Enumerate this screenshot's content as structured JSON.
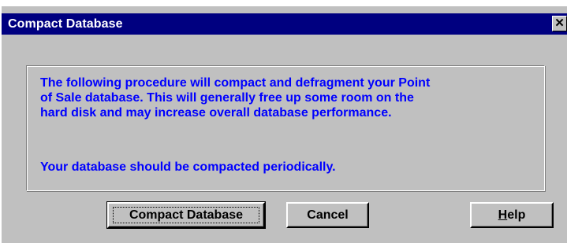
{
  "dialog": {
    "title": "Compact Database",
    "close_glyph": "✕",
    "close_icon": "close-icon"
  },
  "message": {
    "paragraph_1_lines": [
      "The following procedure will compact and defragment your Point",
      "of Sale database.  This will generally free up some room on the",
      "hard disk and may increase overall database performance."
    ],
    "paragraph_2": "Your database should be compacted periodically."
  },
  "buttons": {
    "compact_label": "Compact Database",
    "cancel_label": "Cancel",
    "help_accel": "H",
    "help_rest": "elp"
  },
  "colors": {
    "titlebar": "#000080",
    "dialog_face": "#c0c0c0",
    "message_text": "#0000ff"
  }
}
